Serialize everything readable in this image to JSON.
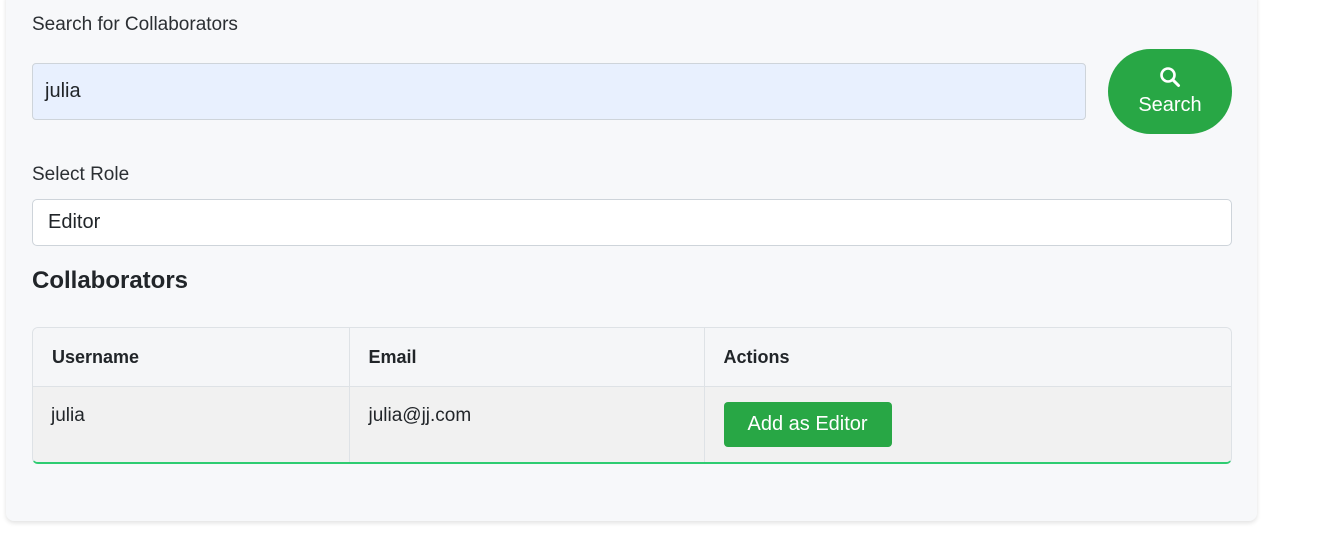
{
  "search": {
    "label": "Search for Collaborators",
    "value": "julia",
    "button_label": "Search",
    "button_icon": "search-icon"
  },
  "role": {
    "label": "Select Role",
    "selected": "Editor"
  },
  "collaborators": {
    "title": "Collaborators",
    "columns": [
      "Username",
      "Email",
      "Actions"
    ],
    "rows": [
      {
        "username": "julia",
        "email": "julia@jj.com",
        "action_label": "Add as Editor"
      }
    ]
  },
  "colors": {
    "accent": "#28a745",
    "input_autofill": "#e8f0fe",
    "table_bottom_border": "#2ecc71"
  }
}
